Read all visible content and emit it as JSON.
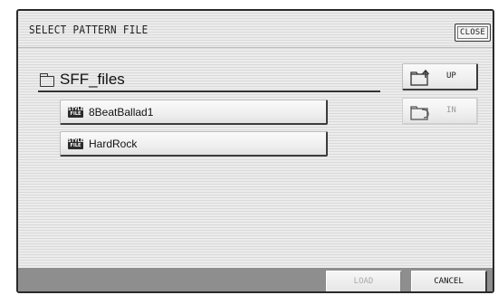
{
  "dialog": {
    "title": "SELECT PATTERN FILE",
    "close_label": "CLOSE"
  },
  "folder": {
    "icon": "folder-icon",
    "name": "SFF_files"
  },
  "files": [
    {
      "icon": "style-file-icon",
      "icon_text": "STYLE FILE",
      "label": "8BeatBallad1"
    },
    {
      "icon": "style-file-icon",
      "icon_text": "STYLE FILE",
      "label": "HardRock"
    }
  ],
  "nav": {
    "up": {
      "icon": "folder-up-icon",
      "label": "UP",
      "enabled": true
    },
    "in": {
      "icon": "folder-in-icon",
      "label": "IN",
      "enabled": false
    }
  },
  "footer": {
    "load_label": "LOAD",
    "load_enabled": false,
    "cancel_label": "CANCEL"
  }
}
